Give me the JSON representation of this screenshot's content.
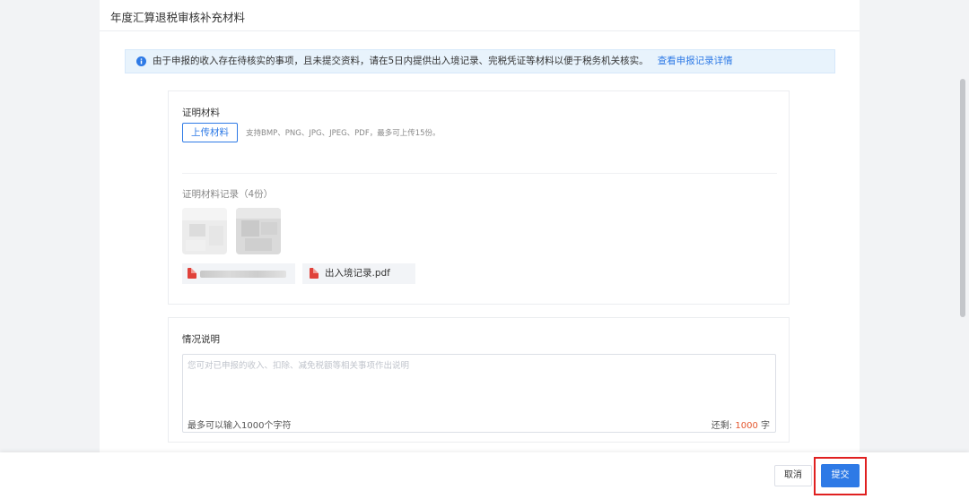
{
  "page": {
    "title": "年度汇算退税审核补充材料"
  },
  "notice": {
    "icon": "info-icon",
    "text": "由于申报的收入存在待核实的事项，且未提交资料，请在5日内提供出入境记录、完税凭证等材料以便于税务机关核实。",
    "link": "查看申报记录详情",
    "accent_color": "#2e7ae6"
  },
  "proof": {
    "label": "证明材料",
    "upload_button": "上传材料",
    "hint": "支持BMP、PNG、JPG、JPEG、PDF，最多可上传15份。",
    "records_label": "证明材料记录（4份）",
    "files": [
      {
        "name": "",
        "icon": "pdf-icon"
      },
      {
        "name": "出入境记录.pdf",
        "icon": "pdf-icon"
      }
    ]
  },
  "explanation": {
    "label": "情况说明",
    "placeholder": "您可对已申报的收入、扣除、减免税额等相关事项作出说明",
    "limit_text": "最多可以输入1000个字符",
    "remaining_prefix": "还剩:",
    "remaining_count": "1000",
    "remaining_suffix": "字"
  },
  "footer": {
    "cancel": "取消",
    "submit": "提交"
  }
}
